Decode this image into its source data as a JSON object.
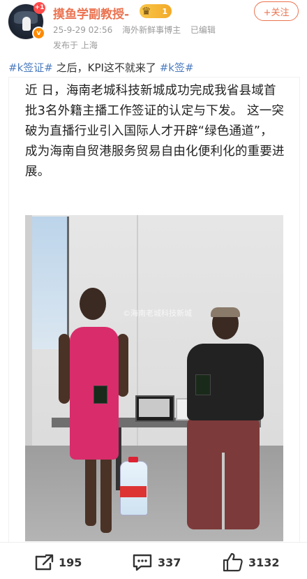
{
  "header": {
    "username": "摸鱼学副教授-",
    "notification_count": "+1",
    "vip_level": "1",
    "timestamp": "25-9-29 02:56",
    "tag": "海外新鲜事博主",
    "edited": "已编辑",
    "location": "发布于 上海",
    "follow_label": "+关注"
  },
  "post": {
    "hashtag1": "#k签证#",
    "middle_text": "之后，KPI这不就来了",
    "hashtag2": "#k签#"
  },
  "article": {
    "paragraph": "近 日，海南老城科技新城成功完成我省县域首批3名外籍主播工作签证的认定与下发。 这一突破为直播行业引入国际人才开辟“绿色通道”，成为海南自贸港服务贸易自由化便利化的重要进展。"
  },
  "photo": {
    "watermark": "©海南老城科技新城"
  },
  "actions": {
    "repost_count": "195",
    "comment_count": "337",
    "like_count": "3132"
  },
  "colors": {
    "accent": "#eb7350",
    "hashtag": "#4b7bbf",
    "text": "#333333",
    "meta": "#9a9a9a"
  }
}
